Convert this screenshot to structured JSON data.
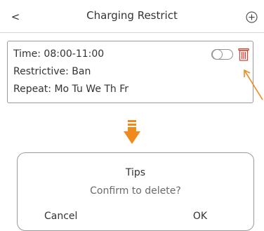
{
  "header": {
    "back_label": "<",
    "title": "Charging Restrict",
    "add_icon": "plus-circle-icon"
  },
  "restriction": {
    "time": "Time: 08:00-11:00",
    "restrictive": "Restrictive: Ban",
    "repeat": "Repeat: Mo Tu We Th Fr",
    "enabled": false,
    "toggle_icon": "toggle-switch",
    "delete_icon": "trash-icon"
  },
  "dialog": {
    "title": "Tips",
    "message": "Confirm to delete?",
    "cancel_label": "Cancel",
    "ok_label": "OK"
  },
  "colors": {
    "accent_orange": "#f08a1c",
    "delete_red": "#e03a2a",
    "border_gray": "#9a9a9a"
  }
}
